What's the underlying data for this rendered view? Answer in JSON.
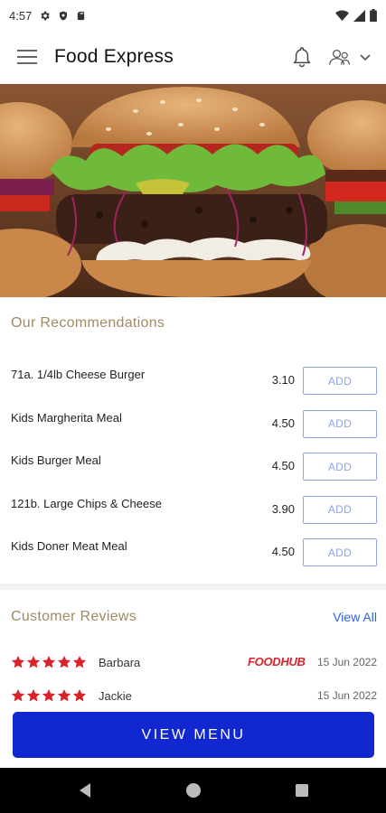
{
  "status_bar": {
    "time": "4:57"
  },
  "app_bar": {
    "title": "Food Express"
  },
  "hero": {
    "image": "burger-hero-photo"
  },
  "recommendations": {
    "title": "Our Recommendations",
    "add_label": "ADD",
    "items": [
      {
        "name": "71a. 1/4lb Cheese Burger",
        "price": "3.10"
      },
      {
        "name": "Kids Margherita Meal",
        "price": "4.50"
      },
      {
        "name": "Kids Burger Meal",
        "price": "4.50"
      },
      {
        "name": "121b. Large Chips & Cheese",
        "price": "3.90"
      },
      {
        "name": "Kids Doner Meat Meal",
        "price": "4.50"
      }
    ]
  },
  "reviews": {
    "title": "Customer Reviews",
    "view_all": "View All",
    "items": [
      {
        "rating": 5,
        "name": "Barbara",
        "source": "FOODHUB",
        "date": "15 Jun 2022"
      },
      {
        "rating": 5,
        "name": "Jackie",
        "source": "",
        "date": "15 Jun 2022"
      }
    ]
  },
  "cta": {
    "label": "VIEW MENU"
  },
  "colors": {
    "accent": "#1127cf",
    "section_title": "#a08a64",
    "star": "#d8232a",
    "link": "#2f62d6",
    "add_border": "#8fa4e6"
  }
}
